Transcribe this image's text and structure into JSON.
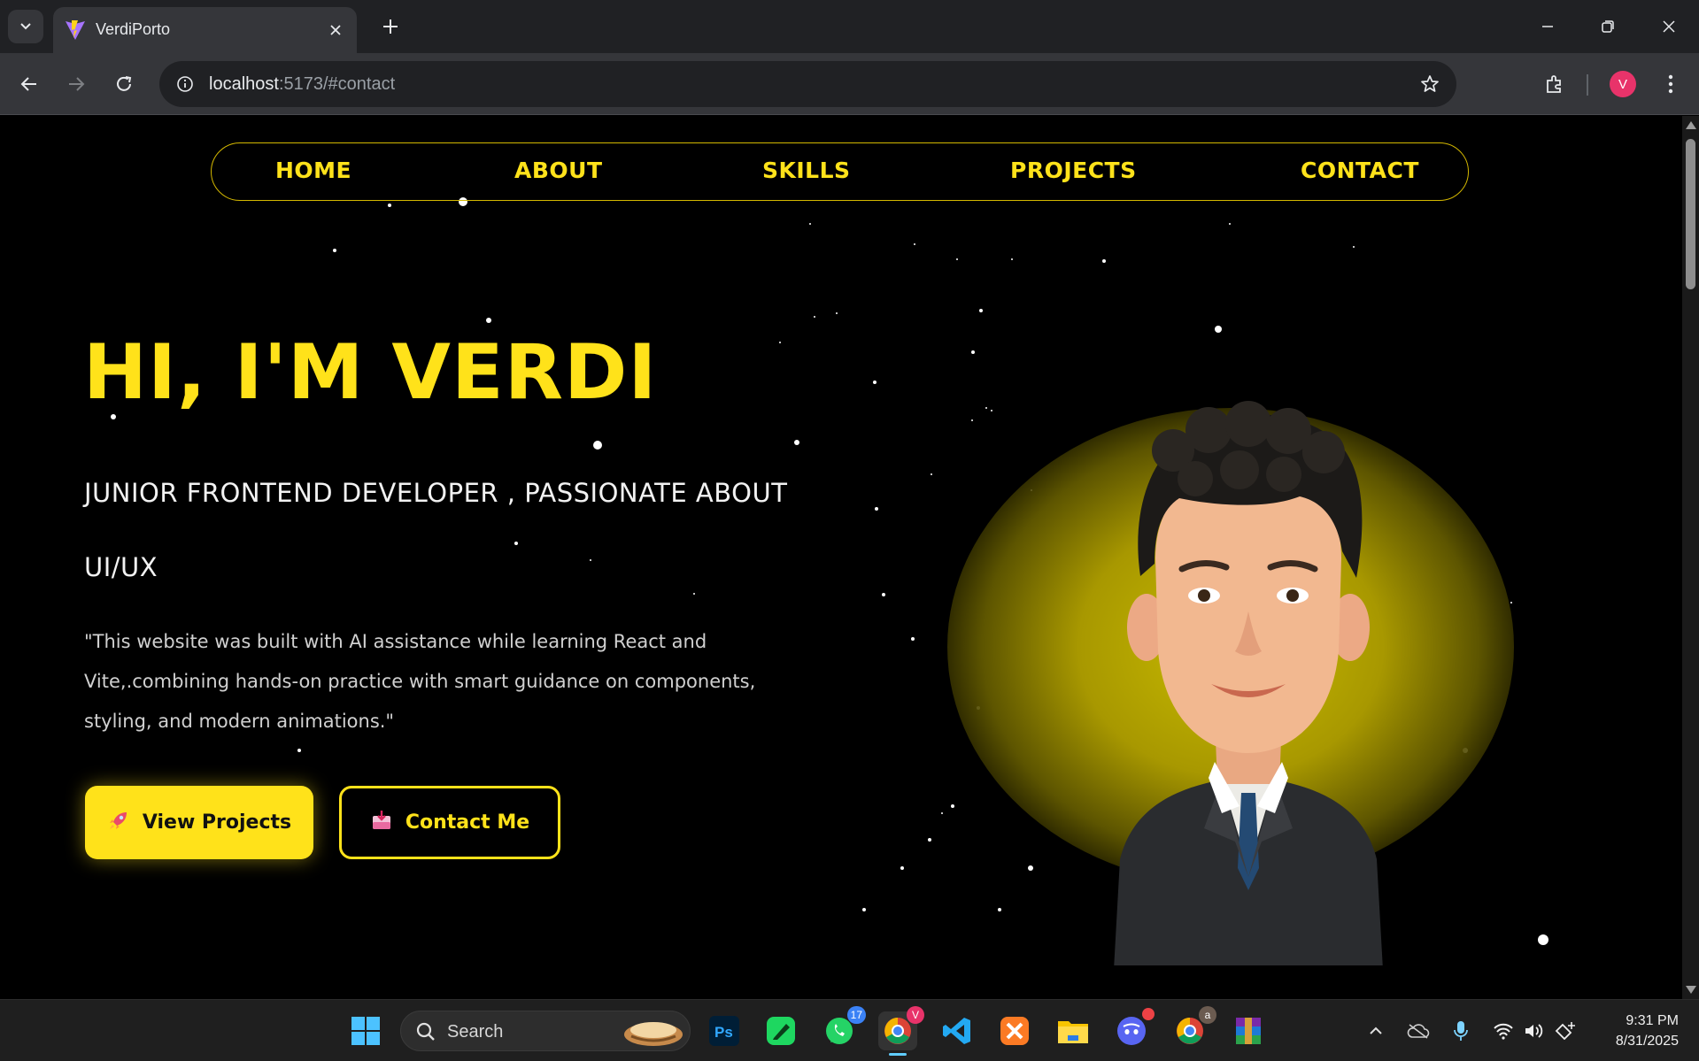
{
  "browser": {
    "tab_title": "VerdiPorto",
    "url_host": "localhost",
    "url_path": ":5173/#contact",
    "profile_initial": "V"
  },
  "nav": {
    "items": [
      "HOME",
      "ABOUT",
      "SKILLS",
      "PROJECTS",
      "CONTACT"
    ]
  },
  "hero": {
    "title": "HI, I'M VERDI",
    "role": "JUNIOR FRONTEND DEVELOPER , PASSIONATE ABOUT UI/UX",
    "quote": "\"This website was built with AI assistance while learning React and Vite,.combining hands-on practice with smart guidance on components, styling, and modern animations.\"",
    "primary_button": "View Projects",
    "primary_icon": "rocket-icon",
    "secondary_button": "Contact Me",
    "secondary_icon": "inbox-icon"
  },
  "colors": {
    "accent": "#ffe21a",
    "background": "#000000",
    "text": "#f2f2f2"
  },
  "taskbar": {
    "search_label": "Search",
    "whatsapp_badge": "17",
    "chrome_badge": "V",
    "chrome2_badge": "a",
    "time": "9:31 PM",
    "date": "8/31/2025"
  }
}
